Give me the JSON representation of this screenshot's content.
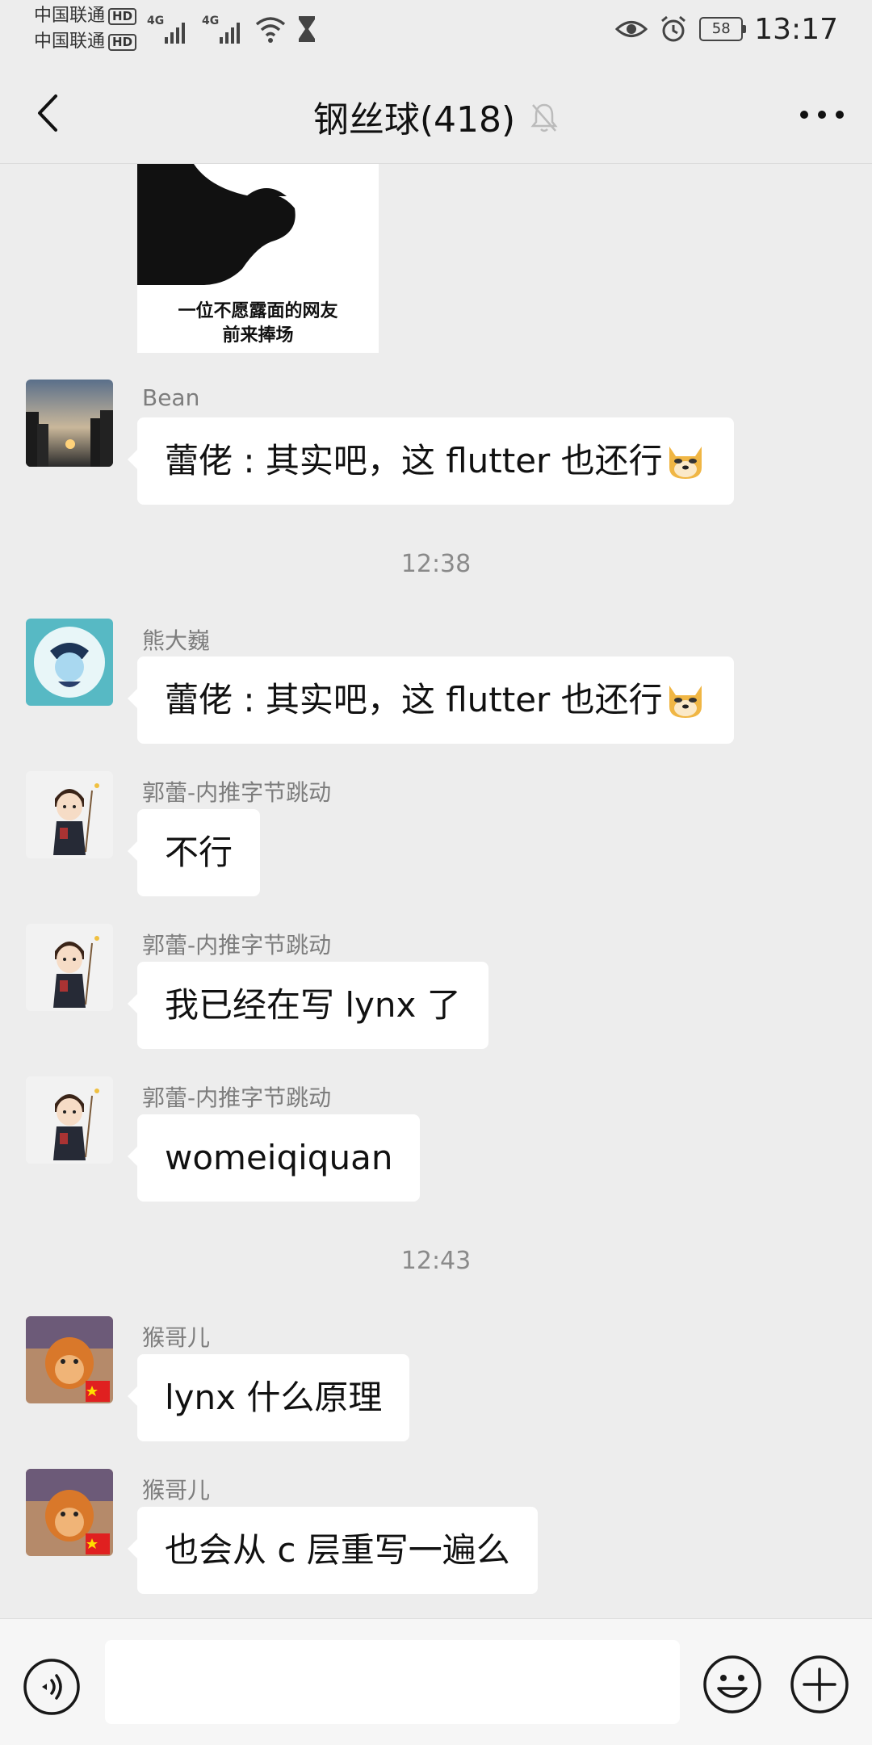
{
  "status_bar": {
    "carrier1": "中国联通",
    "carrier2": "中国联通",
    "hd_badge": "HD",
    "net_type": "4G",
    "battery": "58",
    "time": "13:17"
  },
  "header": {
    "title": "钢丝球(418)"
  },
  "image_message": {
    "caption_line1": "一位不愿露面的网友",
    "caption_line2": "前来捧场"
  },
  "messages": [
    {
      "sender": "Bean",
      "text": "蕾佬 : 其实吧，这 flutter 也还行"
    },
    {
      "timestamp": "12:38"
    },
    {
      "sender": "熊大巍",
      "text": "蕾佬 : 其实吧，这 flutter 也还行"
    },
    {
      "sender": "郭蕾-内推字节跳动",
      "text": "不行"
    },
    {
      "sender": "郭蕾-内推字节跳动",
      "text": "我已经在写 lynx 了"
    },
    {
      "sender": "郭蕾-内推字节跳动",
      "text": "womeiqiquan"
    },
    {
      "timestamp": "12:43"
    },
    {
      "sender": "猴哥儿",
      "text": "lynx 什么原理"
    },
    {
      "sender": "猴哥儿",
      "text": "也会从 c 层重写一遍么"
    }
  ],
  "colors": {
    "background": "#ededed",
    "bubble": "#ffffff",
    "sender_text": "#7d7d7d"
  },
  "icons": {
    "back": "chevron-left-icon",
    "mute": "bell-off-icon",
    "more": "ellipsis-icon",
    "voice": "voice-icon",
    "emoji": "smiley-icon",
    "plus": "plus-circle-icon",
    "doge": "doge-emoji"
  }
}
